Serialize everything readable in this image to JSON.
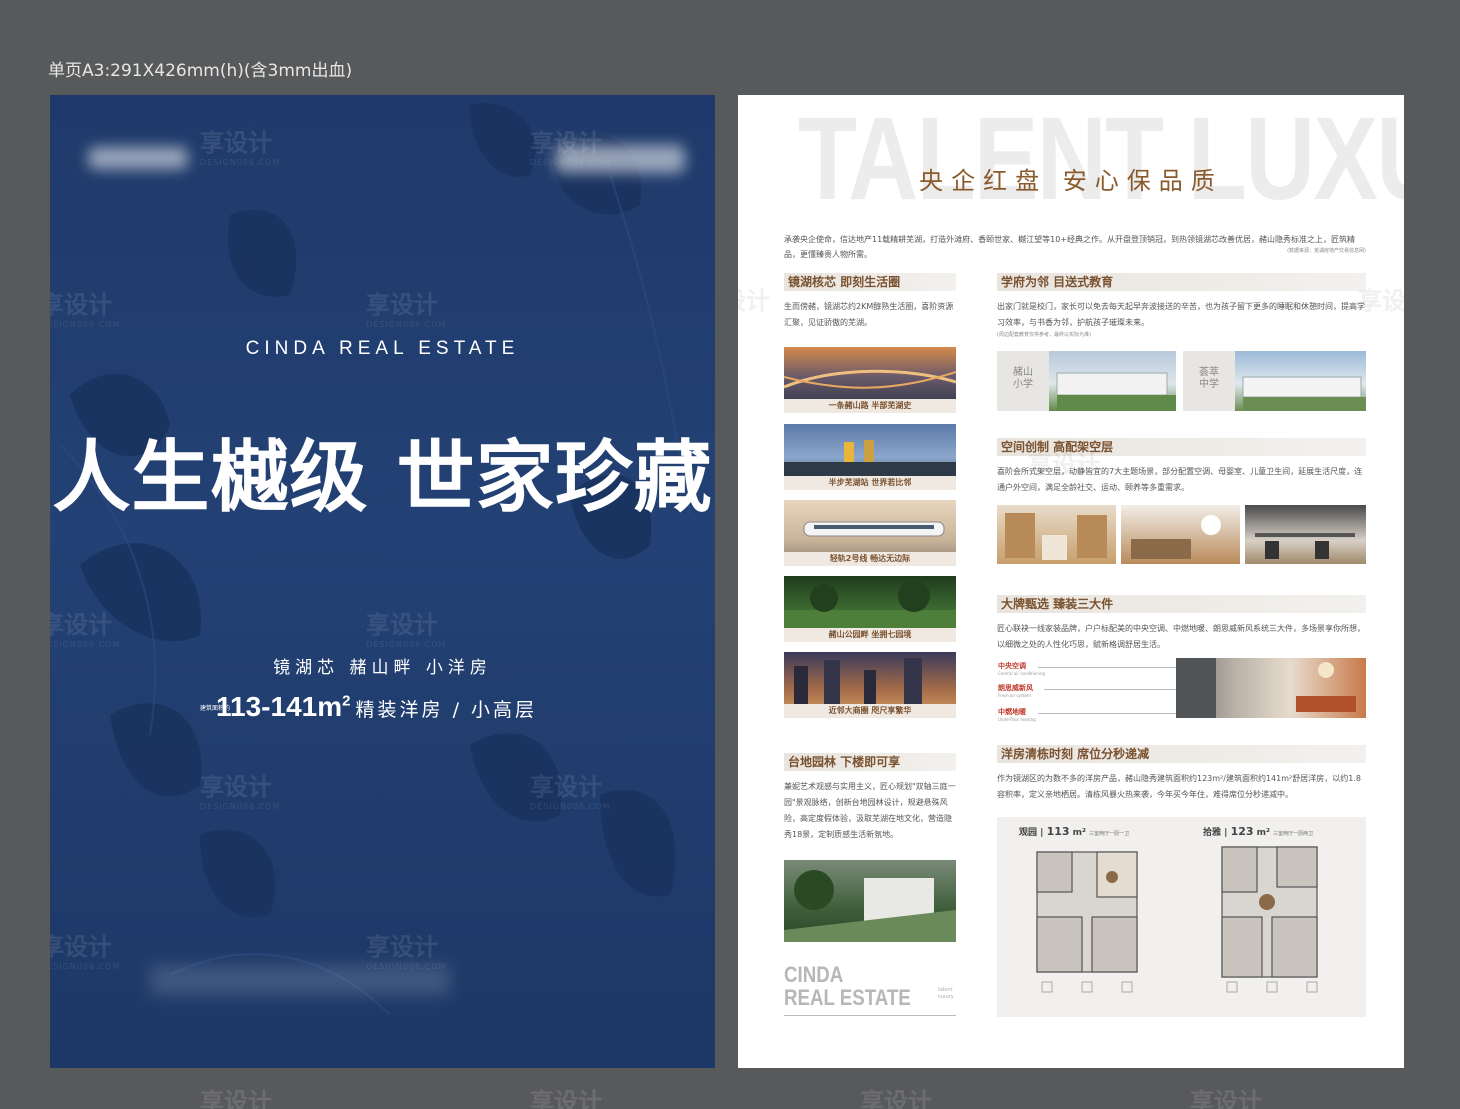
{
  "spec_label": "单页A3:291X426mm(h)(含3mm出血)",
  "left": {
    "brand_en": "CINDA REAL ESTATE",
    "headline": "人生樾级 世家珍藏",
    "sub_location": "镜湖芯 赭山畔 小洋房",
    "sub_area_note": "建筑面积约",
    "sub_area_value": "113-141m",
    "sub_area_sup": "2",
    "sub_area_rest": "精装洋房 / 小高层"
  },
  "right": {
    "big_en": "TALENT LUXURY",
    "slogan": "央企红盘  安心保品质",
    "intro": "承袭央企使命，信达地产11载精耕芜湖，打造外滩府、香颐世家、樾江望等10+经典之作。从开盘登顶销冠，到热领镜湖芯改善优居，赭山隐秀标准之上，匠筑精品，更懂臻贵人物所需。",
    "intro_note": "(数据来源：芜湖房地产交易信息网)",
    "sec1": {
      "title": "镜湖核芯 即刻生活圈",
      "text": "生而傍赭，镜湖芯约2KM醇熟生活圈，喜阶资源汇聚，见证骄傲的芜湖。",
      "captions": [
        "一条赭山路 半部芜湖史",
        "半步芜湖站 世界若比邻",
        "轻轨2号线 畅达无边际",
        "赭山公园畔 坐拥七园境",
        "近邻大商圈 咫尺享繁华"
      ]
    },
    "sec2": {
      "title": "学府为邻 目送式教育",
      "text": "出家门就是校门，家长可以免去每天起早奔波接送的辛苦，也为孩子留下更多的睡眠和休憩时间，提高学习效率，与书香为邻，护航孩子璀璨未来。",
      "note": "(周边配套教育仅供参考，最终以实际为准)",
      "school1": "赭山\n小学",
      "school2": "荟萃\n中学"
    },
    "sec3": {
      "title": "空间创制 高配架空层",
      "text": "喜阶会所式架空层，动静皆宜的7大主题场景，部分配置空调、母婴室、儿童卫生间，延展生活尺度，连通户外空间，满足全龄社交、运动、颐养等多重需求。"
    },
    "sec4": {
      "title": "大牌甄选 臻装三大件",
      "text": "匠心联袂一线家装品牌，户户标配美的中央空调、中燃地暖、朗思威新风系统三大件，多场景享你所想，以细微之处的人性化巧思，赋新格调舒居生活。",
      "items": [
        {
          "name": "中央空调",
          "sub": "Central air conditioning"
        },
        {
          "name": "朗思威新风",
          "sub": "Fresh air system"
        },
        {
          "name": "中燃地暖",
          "sub": "Underfloor heating"
        }
      ]
    },
    "sec5": {
      "title": "台地园林 下楼即可享",
      "text": "兼妮艺术观感与实用主义，匠心规划\"双轴三庭一园\"景观脉络，创新台地园林设计，规避悬殊风险，高定度假体验，汲取芜湖在地文化，营造隐秀18景，定制质感生活新氛地。"
    },
    "sec6": {
      "title": "洋房清栋时刻  席位分秒递减",
      "text": "作为镜湖区的为数不多的洋房产品，赭山隐秀建筑面积约123m²/建筑面积约141m²舒居洋房，以约1.8容积率，定义亲地栖居。清栋风暴火热来袭，今年买今年住，难得席位分秒递减中。"
    },
    "floorplans": [
      {
        "name": "观园",
        "size": "113",
        "desc": "三室两厅一厨一卫"
      },
      {
        "name": "拾雅",
        "size": "123",
        "desc": "三室两厅一厨两卫"
      }
    ],
    "footer_brand": "CINDA\nREAL ESTATE",
    "footer_small": "talent\nluxury"
  },
  "watermark": {
    "cn": "享设计",
    "en": "DESIGN006.COM"
  },
  "colors": {
    "navy": "#234174",
    "accent_brown": "#8a5a2b",
    "bg": "#58595b"
  }
}
